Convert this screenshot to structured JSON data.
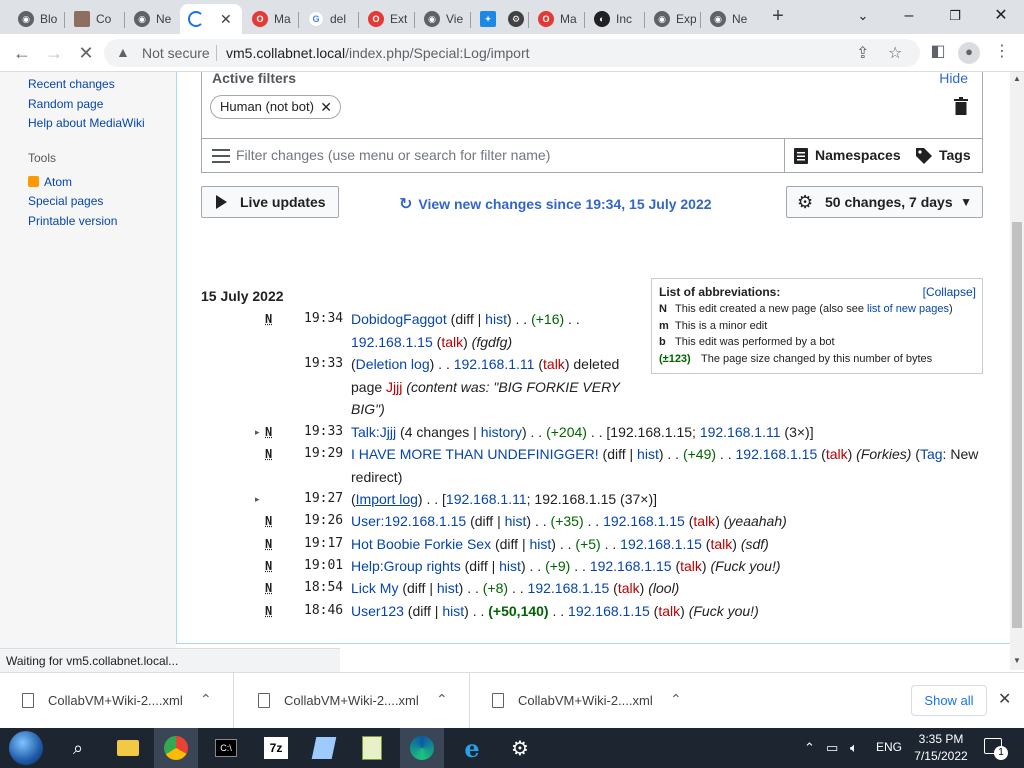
{
  "browser": {
    "tabs": [
      {
        "label": "Blo",
        "icon": "chrome-icon"
      },
      {
        "label": "Co",
        "icon": "avatar-icon"
      },
      {
        "label": "Ne",
        "icon": "chrome-icon"
      },
      {
        "label": "",
        "icon": "loading-icon",
        "close": "✕"
      },
      {
        "label": "Ma",
        "icon": "opera-icon"
      },
      {
        "label": "del",
        "icon": "google-icon"
      },
      {
        "label": "Ext",
        "icon": "opera-icon"
      },
      {
        "label": "Vie",
        "icon": "chrome-icon"
      },
      {
        "label": "",
        "icon": "mediawiki-icon"
      },
      {
        "label": "",
        "icon": "app-icon"
      },
      {
        "label": "Ma",
        "icon": "opera-icon"
      },
      {
        "label": "Inc",
        "icon": "incognito-icon"
      },
      {
        "label": "Exp",
        "icon": "chrome-icon"
      },
      {
        "label": "Ne",
        "icon": "chrome-icon"
      }
    ],
    "new_tab": "+",
    "security": "Not secure",
    "url_host": "vm5.collabnet.local",
    "url_path": "/index.php/Special:Log/import",
    "status_text": "Waiting for vm5.collabnet.local..."
  },
  "sidebar": {
    "nav_links": [
      "Recent changes",
      "Random page",
      "Help about MediaWiki"
    ],
    "tools_heading": "Tools",
    "tools_links": [
      "Atom",
      "Special pages",
      "Printable version"
    ]
  },
  "filters": {
    "active_title": "Active filters",
    "hide_label": "Hide",
    "chip_label": "Human (not bot)",
    "search_placeholder": "Filter changes (use menu or search for filter name)",
    "namespaces_label": "Namespaces",
    "tags_label": "Tags"
  },
  "controls": {
    "live_updates": "Live updates",
    "view_new": "View new changes since 19:34, 15 July 2022",
    "changes_summary": "50 changes, 7 days"
  },
  "abbreviations": {
    "title": "List of abbreviations:",
    "collapse": "[Collapse]",
    "items": [
      {
        "key": "N",
        "text": "This edit created a new page (also see ",
        "link": "list of new pages",
        "tail": ")"
      },
      {
        "key": "m",
        "text": "This is a minor edit"
      },
      {
        "key": "b",
        "text": "This edit was performed by a bot"
      },
      {
        "key": "(±123)",
        "text": "The page size changed by this number of bytes"
      }
    ]
  },
  "date_heading": "15 July 2022",
  "changes": [
    {
      "flag": "N",
      "time": "19:34",
      "page": "DobidogFaggot",
      "diff": "diff",
      "hist": "hist",
      "size": "(+16)",
      "user": "192.168.1.15",
      "talk": "talk",
      "summary": "(fgdfg)"
    },
    {
      "time": "19:33",
      "log": "Deletion log",
      "user": "192.168.1.11",
      "talk": "talk",
      "action": "deleted page",
      "target": "Jjjj",
      "summary": "(content was: \"BIG FORKIE VERY BIG\")"
    },
    {
      "flag": "N",
      "toggle": "▸",
      "time": "19:33",
      "page": "Talk:Jjjj",
      "count": "4 changes",
      "history": "history",
      "size": "(+204)",
      "users": "192.168.1.15; ",
      "user_link": "192.168.1.11",
      "user_count": " (3×)"
    },
    {
      "flag": "N",
      "time": "19:29",
      "page": "I HAVE MORE THAN UNDEFINIGGER!",
      "diff": "diff",
      "hist": "hist",
      "size": "(+49)",
      "user": "192.168.1.15",
      "talk": "talk",
      "summary": "(Forkies)",
      "tag_label": "Tag",
      "tag": "New redirect"
    },
    {
      "toggle": "▸",
      "time": "19:27",
      "log": "Import log",
      "user_link": "192.168.1.11",
      "users": "192.168.1.15",
      "user_count": " (37×)"
    },
    {
      "flag": "N",
      "time": "19:26",
      "page": "User:192.168.1.15",
      "diff": "diff",
      "hist": "hist",
      "size": "(+35)",
      "user": "192.168.1.15",
      "talk": "talk",
      "summary": "(yeaahah)"
    },
    {
      "flag": "N",
      "time": "19:17",
      "page": "Hot Boobie Forkie Sex",
      "diff": "diff",
      "hist": "hist",
      "size": "(+5)",
      "user": "192.168.1.15",
      "talk": "talk",
      "summary": "(sdf)"
    },
    {
      "flag": "N",
      "time": "19:01",
      "page": "Help:Group rights",
      "diff": "diff",
      "hist": "hist",
      "size": "(+9)",
      "user": "192.168.1.15",
      "talk": "talk",
      "summary": "(Fuck you!)"
    },
    {
      "flag": "N",
      "time": "18:54",
      "page": "Lick My",
      "diff": "diff",
      "hist": "hist",
      "size": "(+8)",
      "user": "192.168.1.15",
      "talk": "talk",
      "summary": "(lool)"
    },
    {
      "flag": "N",
      "time": "18:46",
      "page": "User123",
      "diff": "diff",
      "hist": "hist",
      "size": "(+50,140)",
      "big": true,
      "user": "192.168.1.15",
      "talk": "talk",
      "summary": "(Fuck you!)"
    }
  ],
  "downloads": {
    "items": [
      "CollabVM+Wiki-2....xml",
      "CollabVM+Wiki-2....xml",
      "CollabVM+Wiki-2....xml"
    ],
    "show_all": "Show all"
  },
  "taskbar": {
    "language": "ENG",
    "time": "3:35 PM",
    "date": "7/15/2022",
    "notification_count": "1"
  },
  "colors": {
    "link": "#0645ad",
    "redlink": "#ba0000",
    "positive": "#006400",
    "accent": "#36c",
    "taskbar": "#1c2530"
  }
}
